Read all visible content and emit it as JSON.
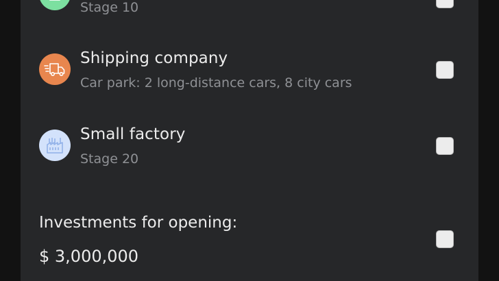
{
  "colors": {
    "background": "#121212",
    "panel": "#262729",
    "text_primary": "#ececec",
    "text_secondary": "#8f9195",
    "green_icon_bg": "#7ce0a0",
    "orange_icon_bg": "#e8864e",
    "blue_icon_bg": "#d3e2fb"
  },
  "items": [
    {
      "subtitle": "Stage 10",
      "icon": "green-business-icon",
      "checked": false
    },
    {
      "title": "Shipping company",
      "subtitle": "Car park: 2 long-distance cars, 8 city cars",
      "icon": "delivery-truck-icon",
      "checked": false
    },
    {
      "title": "Small factory",
      "subtitle": "Stage 20",
      "icon": "factory-icon",
      "checked": false
    }
  ],
  "investments": {
    "label": "Investments for opening:",
    "amount": "$ 3,000,000",
    "checked": false
  }
}
